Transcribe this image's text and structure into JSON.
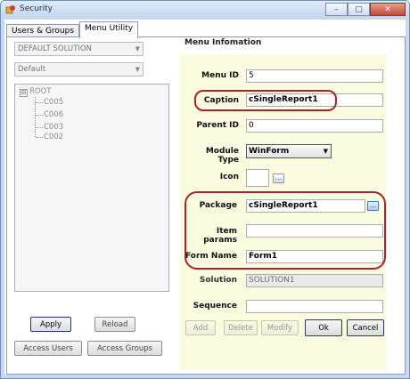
{
  "window": {
    "title": "Security",
    "minimize_glyph": "–",
    "maximize_glyph": "▢",
    "close_glyph": "✕"
  },
  "tabs": [
    {
      "label": "Users & Groups",
      "active": false
    },
    {
      "label": "Menu Utility",
      "active": true
    }
  ],
  "left": {
    "solution_combo": "DEFAULT SOLUTION",
    "default_combo": "Default",
    "tree": {
      "root": "ROOT",
      "expander": "⊟",
      "children": [
        "C005",
        "C006",
        "C003",
        "C002"
      ]
    },
    "apply_label": "Apply",
    "reload_label": "Reload",
    "access_users_label": "Access Users",
    "access_groups_label": "Access Groups"
  },
  "menu_info": {
    "title": "Menu Infomation",
    "menu_id_label": "Menu ID",
    "menu_id": "5",
    "caption_label": "Caption",
    "caption": "cSingleReport1",
    "parent_id_label": "Parent ID",
    "parent_id": "0",
    "module_type_label": "Module Type",
    "module_type": "WinForm",
    "icon_label": "Icon",
    "package_label": "Package",
    "package": "cSingleReport1",
    "item_params_label": "Item params",
    "item_params": "",
    "form_name_label": "Form Name",
    "form_name": "Form1",
    "solution_label": "Solution",
    "solution": "SOLUTION1",
    "sequence_label": "Sequence",
    "sequence": "",
    "ellipsis_glyph": "...",
    "add_label": "Add",
    "delete_label": "Delete",
    "modify_label": "Modify",
    "ok_label": "Ok",
    "cancel_label": "Cancel"
  },
  "colors": {
    "panel_background": "#fbfbe0",
    "highlight": "#a3252c",
    "window_frame": "#c7d9ee"
  }
}
